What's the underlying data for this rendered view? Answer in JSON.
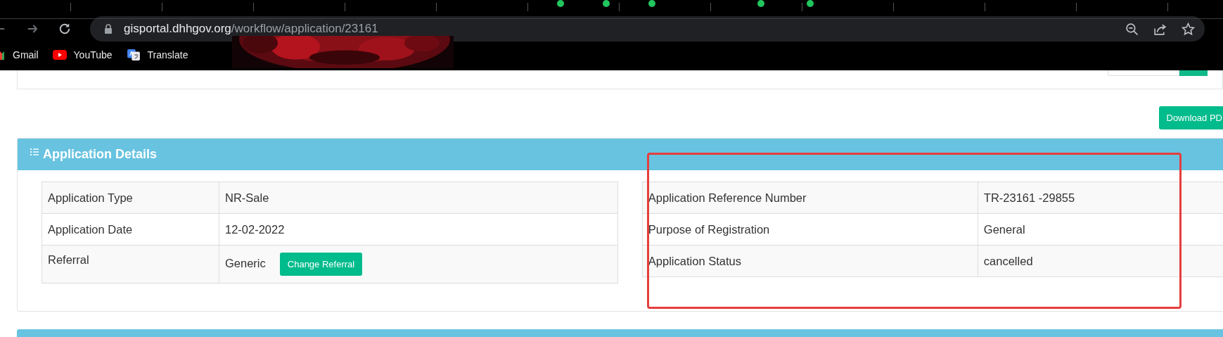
{
  "browser": {
    "address_bar": {
      "domain": "gisportal.dhhgov.org",
      "path": "/workflow/application/23161"
    },
    "bookmarks": [
      {
        "label": "Gmail",
        "kind": "gmail"
      },
      {
        "label": "YouTube",
        "kind": "youtube"
      },
      {
        "label": "Translate",
        "kind": "translate"
      }
    ]
  },
  "page": {
    "download_button": "Download PD",
    "card": {
      "title": "Application Details",
      "left_table": [
        {
          "label": "Application Type",
          "value": "NR-Sale"
        },
        {
          "label": "Application Date",
          "value": "12-02-2022"
        },
        {
          "label": "Referral",
          "value": "Generic",
          "button": "Change Referral"
        }
      ],
      "right_table": [
        {
          "label": "Application Reference Number",
          "value": "TR-23161 -29855"
        },
        {
          "label": "Purpose of Registration",
          "value": "General"
        },
        {
          "label": "Application Status",
          "value": "cancelled"
        }
      ]
    },
    "highlight": {
      "kind": "red-outline"
    }
  }
}
